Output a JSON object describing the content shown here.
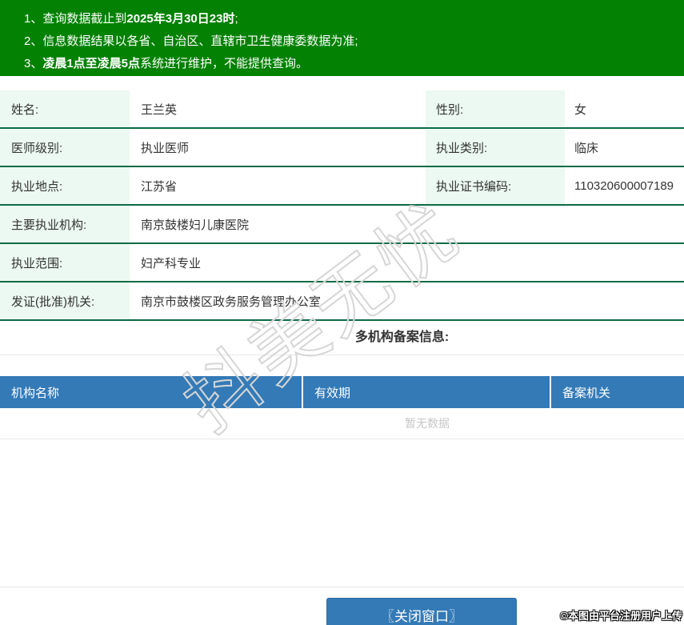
{
  "banner": {
    "notices": [
      {
        "num": "1、",
        "pre": "查询数据截止到",
        "bold": "2025年3月30日23时",
        "post": ";"
      },
      {
        "num": "2、",
        "pre": "信息数据结果以各省、自治区、直辖市卫生健康委数据为准;",
        "bold": "",
        "post": ""
      },
      {
        "num": "3、",
        "pre": "",
        "bold": "凌晨1点至凌晨5点",
        "post": "系统进行维护，不能提供查询。"
      }
    ]
  },
  "info": {
    "rows": [
      {
        "label": "姓名:",
        "value": "王兰英",
        "label2": "性别:",
        "value2": "女"
      },
      {
        "label": "医师级别:",
        "value": "执业医师",
        "label2": "执业类别:",
        "value2": "临床"
      },
      {
        "label": "执业地点:",
        "value": "江苏省",
        "label2": "执业证书编码:",
        "value2": "110320600007189"
      },
      {
        "label": "主要执业机构:",
        "value": "南京鼓楼妇儿康医院"
      },
      {
        "label": "执业范围:",
        "value": "妇产科专业"
      },
      {
        "label": "发证(批准)机关:",
        "value": "南京市鼓楼区政务服务管理办公室"
      }
    ]
  },
  "filing": {
    "heading": "多机构备案信息:",
    "columns": [
      "机构名称",
      "有效期",
      "备案机关"
    ],
    "empty_text": "暂无数据"
  },
  "watermark": "抖美无忧",
  "footer": {
    "close_button": "〖关闭窗口〗",
    "copyright": "©本图由平台注册用户上传"
  },
  "colors": {
    "banner_green": "#028102",
    "row_border_green": "#0c6b45",
    "label_bg_mint": "#ecf9f2",
    "header_blue": "#337ab7",
    "button_blue": "#337ab7",
    "empty_text_gray": "#c7c7c7"
  }
}
